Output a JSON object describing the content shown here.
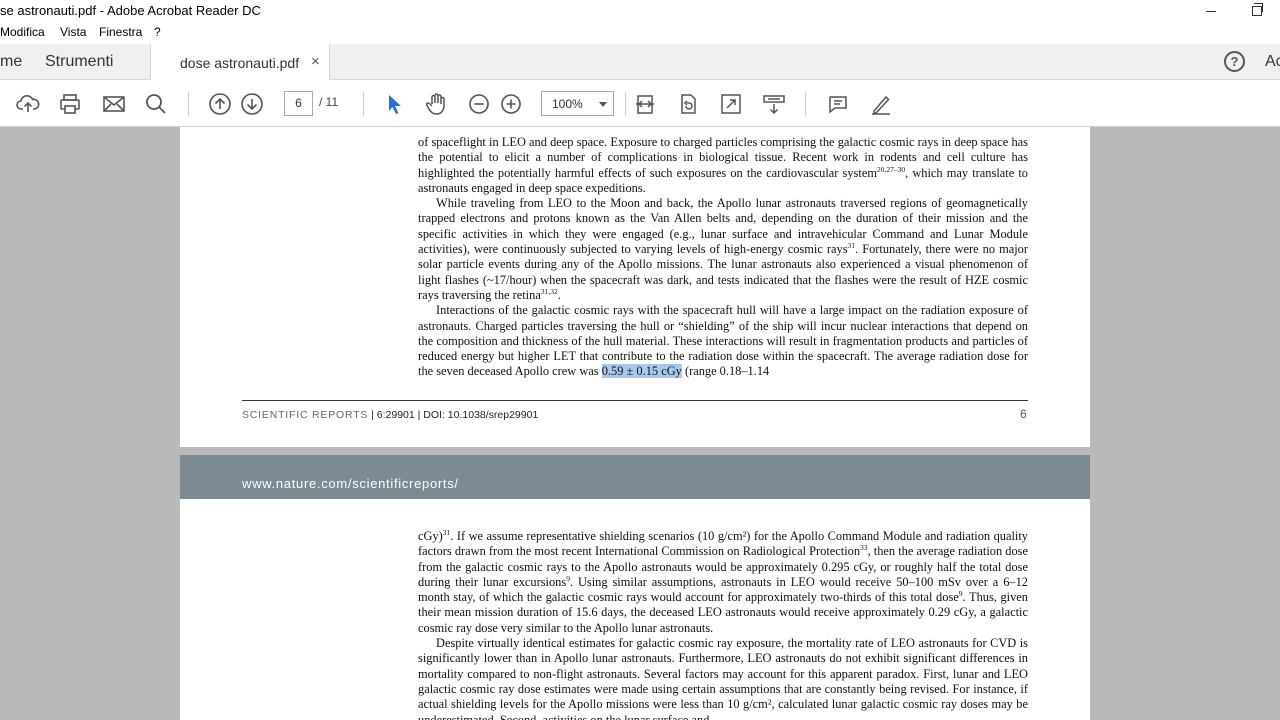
{
  "window": {
    "title": "se astronauti.pdf - Adobe Acrobat Reader DC"
  },
  "menu": {
    "items": [
      "Modifica",
      "Vista",
      "Finestra",
      "?"
    ]
  },
  "tabs": {
    "home_label": "me",
    "tools_label": "Strumenti",
    "document_label": "dose astronauti.pdf",
    "close_glyph": "×",
    "help_glyph": "?",
    "account_label": "Ac"
  },
  "toolbar": {
    "icons": [
      "upload-icon",
      "print-icon",
      "mail-icon",
      "search-icon",
      "page-up-icon",
      "page-down-icon",
      "select-cursor-icon",
      "hand-icon",
      "zoom-out-icon",
      "zoom-in-icon",
      "fit-page-icon",
      "rotate-icon",
      "full-screen-icon",
      "scroll-mode-icon",
      "comment-icon",
      "sign-icon"
    ],
    "current_page": "6",
    "page_total": "/ 11",
    "zoom": "100%"
  },
  "page1": {
    "p1_text": "of spaceflight in LEO and deep space. Exposure to charged particles comprising the galactic cosmic rays in deep space has the potential to elicit a number of complications in biological tissue. Recent work in rodents and cell culture has highlighted the potentially harmful effects of such exposures on the cardiovascular system",
    "p1_ref": "20,27–30",
    "p1_end": ", which may translate to astronauts engaged in deep space expeditions.",
    "p2_text": "While traveling from LEO to the Moon and back, the Apollo lunar astronauts traversed regions of geomagnetically trapped electrons and protons known as the Van Allen belts and, depending on the duration of their mission and the specific activities in which they were engaged (e.g., lunar surface and intravehicular Command and Lunar Module activities), were continuously subjected to varying levels of high-energy cosmic rays",
    "p2_ref1": "31",
    "p2_mid": ". Fortunately, there were no major solar particle events during any of the Apollo missions. The lunar astronauts also experienced a visual phenomenon of light flashes (~17/hour) when the spacecraft was dark, and tests indicated that the flashes were the result of HZE cosmic rays traversing the retina",
    "p2_ref2": "31,32",
    "p2_end": ".",
    "p3_text": "Interactions of the galactic cosmic rays with the spacecraft hull will have a large impact on the radiation exposure of astronauts. Charged particles traversing the hull or “shielding” of the ship will incur nuclear interactions that depend on the composition and thickness of the hull material. These interactions will result in fragmentation products and particles of reduced energy but higher LET that contribute to the radiation dose within the spacecraft. The average radiation dose for the seven deceased Apollo crew was ",
    "p3_highlight": "0.59 ± 0.15 cGy",
    "p3_end": " (range 0.18–1.14",
    "footer_journal": "SCIENTIFIC REPORTS",
    "footer_meta": " | 6:29901 | DOI: 10.1038/srep29901",
    "footer_page": "6"
  },
  "page2": {
    "banner_url": "www.nature.com/scientificreports/",
    "p1_start": "cGy)",
    "p1_ref1": "31",
    "p1_text": ". If we assume representative shielding scenarios (10 g/cm²) for the Apollo Command Module and radiation quality factors drawn from the most recent International Commission on Radiological Protection",
    "p1_ref2": "33",
    "p1_mid": ", then the average radiation dose from the galactic cosmic rays to the Apollo astronauts would be approximately 0.295 cGy, or roughly half the total dose during their lunar excursions",
    "p1_ref3": "9",
    "p1_mid2": ". Using similar assumptions, astronauts in LEO would receive 50–100 mSv over a 6–12 month stay, of which the galactic cosmic rays would account for approximately two-thirds of this total dose",
    "p1_ref4": "9",
    "p1_end": ". Thus, given their mean mission duration of 15.6 days, the deceased LEO astronauts would receive approximately 0.29 cGy, a galactic cosmic ray dose very similar to the Apollo lunar astronauts.",
    "p2_text": "Despite virtually identical estimates for galactic cosmic ray exposure, the mortality rate of LEO astronauts for CVD is significantly lower than in Apollo lunar astronauts. Furthermore, LEO astronauts do not exhibit significant differences in mortality compared to non-flight astronauts. Several factors may account for this apparent paradox. First, lunar and LEO galactic cosmic ray dose estimates were made using certain assumptions that are constantly being revised. For instance, if actual shielding levels for the Apollo missions were less than 10 g/cm², calculated lunar galactic cosmic ray doses may be underestimated. Second, activities on the lunar surface and"
  }
}
